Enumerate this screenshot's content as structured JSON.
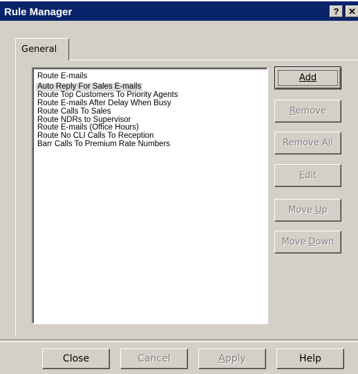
{
  "window": {
    "title": "Rule Manager",
    "help_label": "?",
    "close_label": "✕"
  },
  "tabs": [
    {
      "label": "General"
    }
  ],
  "rules": [
    "Route E-mails",
    "Auto Reply For Sales E-mails",
    "Route Top Customers To Priority Agents",
    "Route E-mails After Delay When Busy",
    "Route Calls To Sales",
    "Route NDRs to Supervisor",
    "Route E-mails (Office Hours)",
    "Route No CLI Calls To Reception",
    "Barr Calls To Premium Rate Numbers"
  ],
  "selected_rule": "Auto Reply For Sales E-mails",
  "side_buttons": {
    "add": "Add",
    "remove_pre": "",
    "remove_key": "R",
    "remove_post": "emove",
    "remove_all_pre": "Remove A",
    "remove_all_key": "l",
    "remove_all_post": "l",
    "edit_pre": "",
    "edit_key": "E",
    "edit_post": "dit",
    "move_up_pre": "Move ",
    "move_up_key": "U",
    "move_up_post": "p",
    "move_down_pre": "Move ",
    "move_down_key": "D",
    "move_down_post": "own"
  },
  "bottom_buttons": {
    "close": "Close",
    "cancel": "Cancel",
    "apply_key": "A",
    "apply_post": "pply",
    "help": "Help"
  }
}
